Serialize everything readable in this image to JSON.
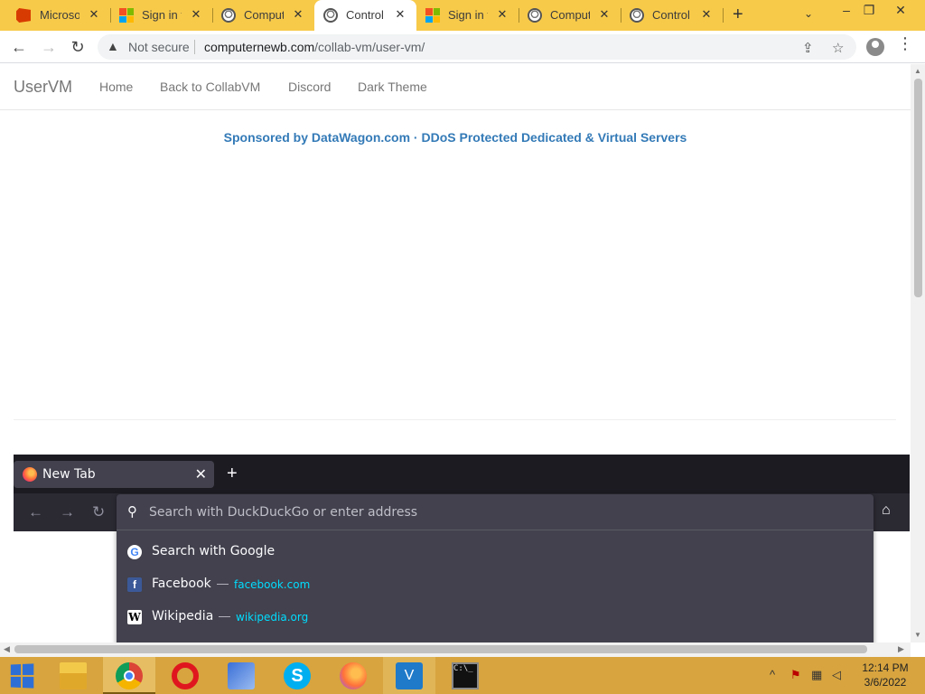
{
  "browser": {
    "tabs": [
      {
        "title": "Microsoft",
        "icon": "office-icon"
      },
      {
        "title": "Sign in to",
        "icon": "microsoft-icon"
      },
      {
        "title": "Computer",
        "icon": "vm-icon"
      },
      {
        "title": "Control C",
        "icon": "vm-icon",
        "active": true
      },
      {
        "title": "Sign in to",
        "icon": "microsoft-icon"
      },
      {
        "title": "Computer",
        "icon": "vm-icon"
      },
      {
        "title": "Control C",
        "icon": "vm-icon"
      }
    ],
    "new_tab_symbol": "+",
    "address": {
      "security_label": "Not secure",
      "url_host": "computernewb.com",
      "url_path": "/collab-vm/user-vm/"
    }
  },
  "page": {
    "brand": "UserVM",
    "nav_links": [
      "Home",
      "Back to CollabVM",
      "Discord",
      "Dark Theme"
    ],
    "sponsor_text": "Sponsored by DataWagon.com · DDoS Protected Dedicated & Virtual Servers",
    "link_color": "#337ab7"
  },
  "vm_screen": {
    "tab_title": "New Tab",
    "url_placeholder": "Search with DuckDuckGo or enter address",
    "suggestions": [
      {
        "title": "Search with Google",
        "url": "",
        "icon": "google-icon"
      },
      {
        "title": "Facebook",
        "url": "facebook.com",
        "icon": "facebook-icon"
      },
      {
        "title": "Wikipedia",
        "url": "wikipedia.org",
        "icon": "wikipedia-icon"
      }
    ],
    "separator": "—"
  },
  "taskbar": {
    "apps": [
      "file-explorer",
      "chrome",
      "opera",
      "network-tool",
      "skype",
      "firefox",
      "vscode",
      "command-prompt"
    ],
    "time": "12:14 PM",
    "date": "3/6/2022"
  }
}
